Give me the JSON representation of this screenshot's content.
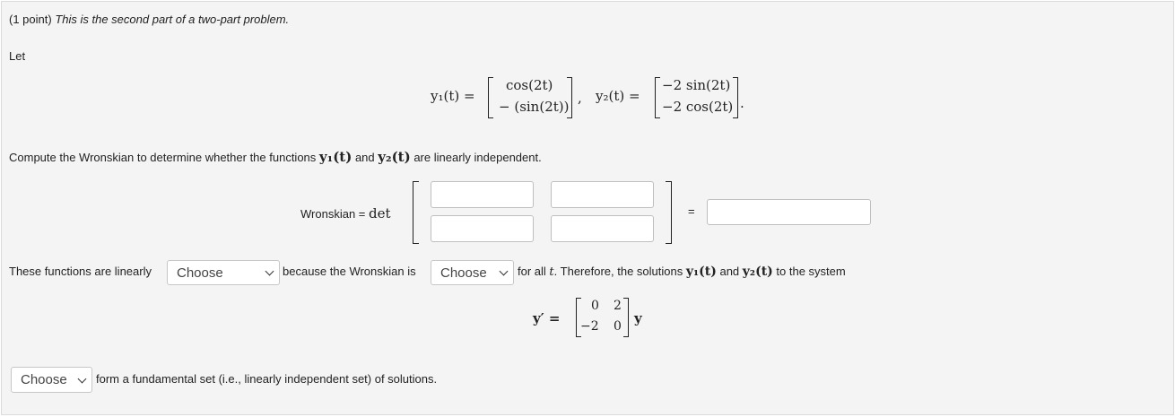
{
  "header": {
    "points": "(1 point)",
    "description": "This is the second part of a two-part problem."
  },
  "intro": {
    "let": "Let"
  },
  "equation1": {
    "y1_label": "y₁(t) =",
    "y1_top": "cos(2t)",
    "y1_bottom": "− (sin(2t))",
    "sep": ",",
    "y2_label": "y₂(t) =",
    "y2_top": "−2 sin(2t)",
    "y2_bottom": "−2 cos(2t)",
    "period": "."
  },
  "wronskian_prompt": {
    "before": "Compute the Wronskian to determine whether the functions",
    "y1": "y₁(t)",
    "and": "and",
    "y2": "y₂(t)",
    "after": "are linearly independent."
  },
  "wronskian": {
    "label": "Wronskian =",
    "det": "det",
    "equals": "=",
    "cells": [
      "",
      "",
      "",
      ""
    ],
    "result": ""
  },
  "conclusion": {
    "text1": "These functions are linearly",
    "select1": "Choose",
    "text2": "because the Wronskian is",
    "select2": "Choose",
    "text3": "for all",
    "t": "t",
    "text4": ". Therefore, the solutions",
    "y1": "y₁(t)",
    "and": "and",
    "y2": "y₂(t)",
    "text5": "to the system"
  },
  "system": {
    "lhs": "y′ =",
    "matrix": [
      "0",
      "2",
      "−2",
      "0"
    ],
    "rhs": "y"
  },
  "final": {
    "select3": "Choose",
    "text": "form a fundamental set (i.e., linearly independent set) of solutions."
  },
  "icons": {
    "dropdown": "chevron-down-icon"
  }
}
